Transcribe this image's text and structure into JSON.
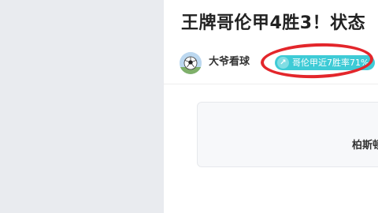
{
  "article": {
    "title": "王牌哥伦甲4胜3！状态"
  },
  "author": {
    "name": "大爷看球",
    "avatar_icon": "soccer-ball-avatar"
  },
  "topic_tag": {
    "label": "哥伦甲近7胜率71%",
    "icon_glyph": "↗",
    "color": "#3ecbd6"
  },
  "highlight": {
    "color": "#e3262b"
  },
  "embed_card": {
    "text": "柏斯顿"
  }
}
